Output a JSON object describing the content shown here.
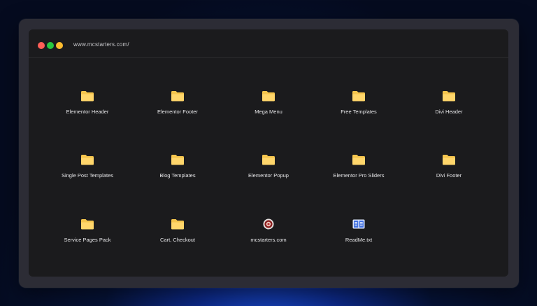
{
  "window": {
    "url": "www.mcstarters.com/"
  },
  "items": [
    {
      "label": "Elementor Header",
      "icon": "folder-icon"
    },
    {
      "label": "Elementor Footer",
      "icon": "folder-icon"
    },
    {
      "label": "Mega Menu",
      "icon": "folder-icon"
    },
    {
      "label": "Free Templates",
      "icon": "folder-icon"
    },
    {
      "label": "Divi Header",
      "icon": "folder-icon"
    },
    {
      "label": "Single Post Templates",
      "icon": "folder-icon"
    },
    {
      "label": "Blog Templates",
      "icon": "folder-icon"
    },
    {
      "label": "Elementor Popup",
      "icon": "folder-icon"
    },
    {
      "label": "Elementor Pro Sliders",
      "icon": "folder-icon"
    },
    {
      "label": "Divi Footer",
      "icon": "folder-icon"
    },
    {
      "label": "Service Pages Pack",
      "icon": "folder-icon"
    },
    {
      "label": "Cart, Checkout",
      "icon": "folder-icon"
    },
    {
      "label": "mcstarters.com",
      "icon": "website-link-icon"
    },
    {
      "label": "ReadMe.txt",
      "icon": "readme-book-icon"
    }
  ],
  "colors": {
    "folder": "#ffd66b",
    "folder_tab": "#f5c54d",
    "dot_red": "#ff5f57",
    "dot_green": "#28c840",
    "dot_yellow": "#febc2e"
  }
}
